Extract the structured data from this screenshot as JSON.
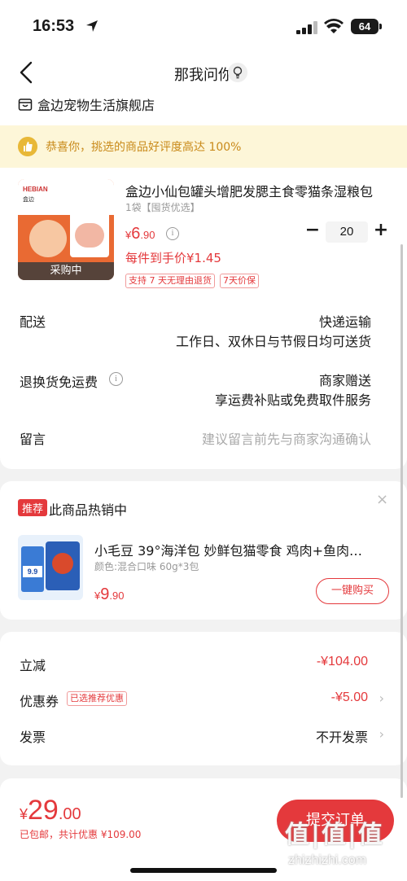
{
  "status": {
    "time": "16:53",
    "battery": "64"
  },
  "nav": {
    "title": "那我问你",
    "store_name": "盒边宠物生活旗舰店"
  },
  "banner": {
    "text": "恭喜你，挑选的商品好评度高达 100%"
  },
  "product": {
    "title": "盒边小仙包罐头增肥发腮主食零猫条湿粮包",
    "spec": "1袋【囤货优选】",
    "price_symbol": "¥",
    "price_int": "6",
    "price_dec": ".90",
    "unit_price": "每件到手价¥1.45",
    "quantity": "20",
    "image_tag": "采购中",
    "image_brand": "HEBIAN",
    "image_brand_cn": "盒边",
    "tags": [
      "支持 7 天无理由退货",
      "7天价保"
    ]
  },
  "rows": {
    "delivery_label": "配送",
    "delivery_value": "快递运输",
    "delivery_sub": "工作日、双休日与节假日均可送货",
    "return_label": "退换货免运费",
    "return_value": "商家赠送",
    "return_sub": "享运费补贴或免费取件服务",
    "note_label": "留言",
    "note_placeholder": "建议留言前先与商家沟通确认"
  },
  "recommend": {
    "badge": "推荐",
    "title": "此商品热销中",
    "close": "×",
    "name": "小毛豆 39°海洋包 妙鲜包猫零食 鸡肉+鱼肉…",
    "spec": "颜色:混合口味 60g*3包",
    "price_symbol": "¥",
    "price_int": "9",
    "price_dec": ".90",
    "buy": "一键购买",
    "image_price": "9.9"
  },
  "summary": {
    "discount_label": "立减",
    "discount_value": "-¥104.00",
    "coupon_label": "优惠券",
    "coupon_tag": "已选推荐优惠",
    "coupon_value": "-¥5.00",
    "invoice_label": "发票",
    "invoice_value": "不开发票"
  },
  "footer": {
    "total_symbol": "¥",
    "total_int": "29",
    "total_dec": ".00",
    "total_sub": "已包邮，共计优惠 ¥109.00",
    "submit": "提交订单"
  },
  "watermark": {
    "text": "值|值|值",
    "url": "zhizhizhi.com"
  },
  "colors": {
    "accent": "#e4393c",
    "banner_bg": "#fdf6d8",
    "banner_text": "#c98a1a"
  }
}
